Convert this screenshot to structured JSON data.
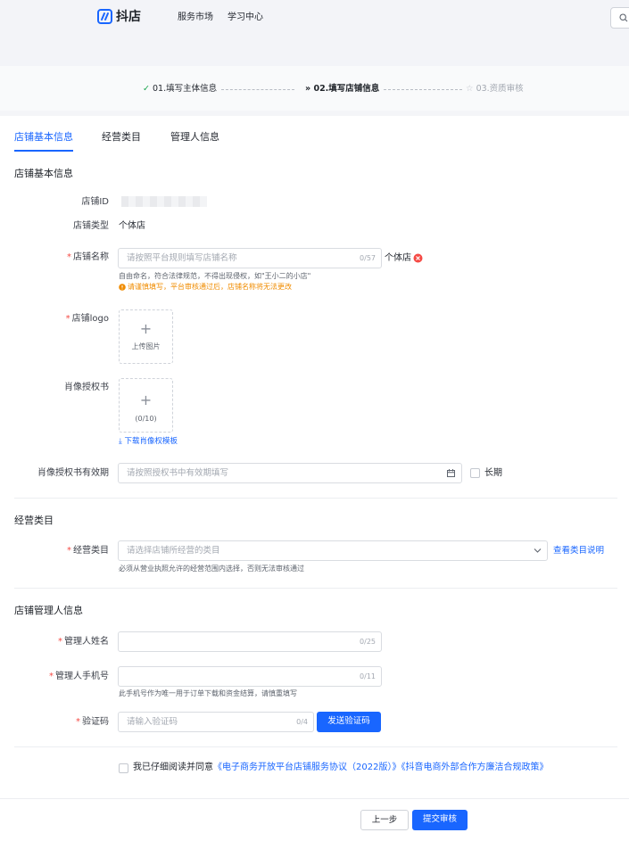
{
  "header": {
    "logo_text": "抖店",
    "nav": [
      "服务市场",
      "学习中心"
    ]
  },
  "steps": [
    {
      "label": "01.填写主体信息",
      "status": "done",
      "mark": "✓"
    },
    {
      "label": "02.填写店铺信息",
      "status": "current",
      "mark": "»"
    },
    {
      "label": "03.资质审核",
      "status": "pending",
      "mark": "☆"
    }
  ],
  "tabs": [
    "店铺基本信息",
    "经营类目",
    "管理人信息"
  ],
  "basic": {
    "title": "店铺基本信息",
    "shop_id_label": "店铺ID",
    "shop_type_label": "店铺类型",
    "shop_type_value": "个体店",
    "shop_name_label": "店铺名称",
    "shop_name_placeholder": "请按照平台规则填写店铺名称",
    "shop_name_count": "0/57",
    "shop_name_suffix": "个体店",
    "shop_name_hint": "自由命名，符合法律规范，不得出现侵权，如\"王小二的小店\"",
    "shop_name_warn": "请谨慎填写，平台审核通过后，店铺名称将无法更改",
    "logo_label": "店铺logo",
    "logo_upload_text": "上传图片",
    "portrait_label": "肖像授权书",
    "portrait_upload_text": "(0/10)",
    "portrait_download": "下载肖像权模板",
    "validity_label": "肖像授权书有效期",
    "validity_placeholder": "请按照授权书中有效期填写",
    "long_term_label": "长期"
  },
  "category": {
    "title": "经营类目",
    "label": "经营类目",
    "placeholder": "请选择店铺所经营的类目",
    "link": "查看类目说明",
    "hint": "必须从营业执照允许的经营范围内选择，否则无法审核通过"
  },
  "manager": {
    "title": "店铺管理人信息",
    "name_label": "管理人姓名",
    "name_count": "0/25",
    "phone_label": "管理人手机号",
    "phone_count": "0/11",
    "phone_hint": "此手机号作为唯一用于订单下载和资金结算，请慎重填写",
    "code_label": "验证码",
    "code_placeholder": "请输入验证码",
    "code_count": "0/4",
    "send_code": "发送验证码"
  },
  "agreement": {
    "prefix": "我已仔细阅读并同意",
    "doc1": "《电子商务开放平台店铺服务协议（2022版）》",
    "doc2": "《抖音电商外部合作方廉洁合规政策》"
  },
  "footer": {
    "prev": "上一步",
    "submit": "提交审核"
  },
  "colors": {
    "primary": "#1966ff",
    "required": "#f54a45",
    "warning": "#f08c00",
    "done": "#17a34a"
  }
}
